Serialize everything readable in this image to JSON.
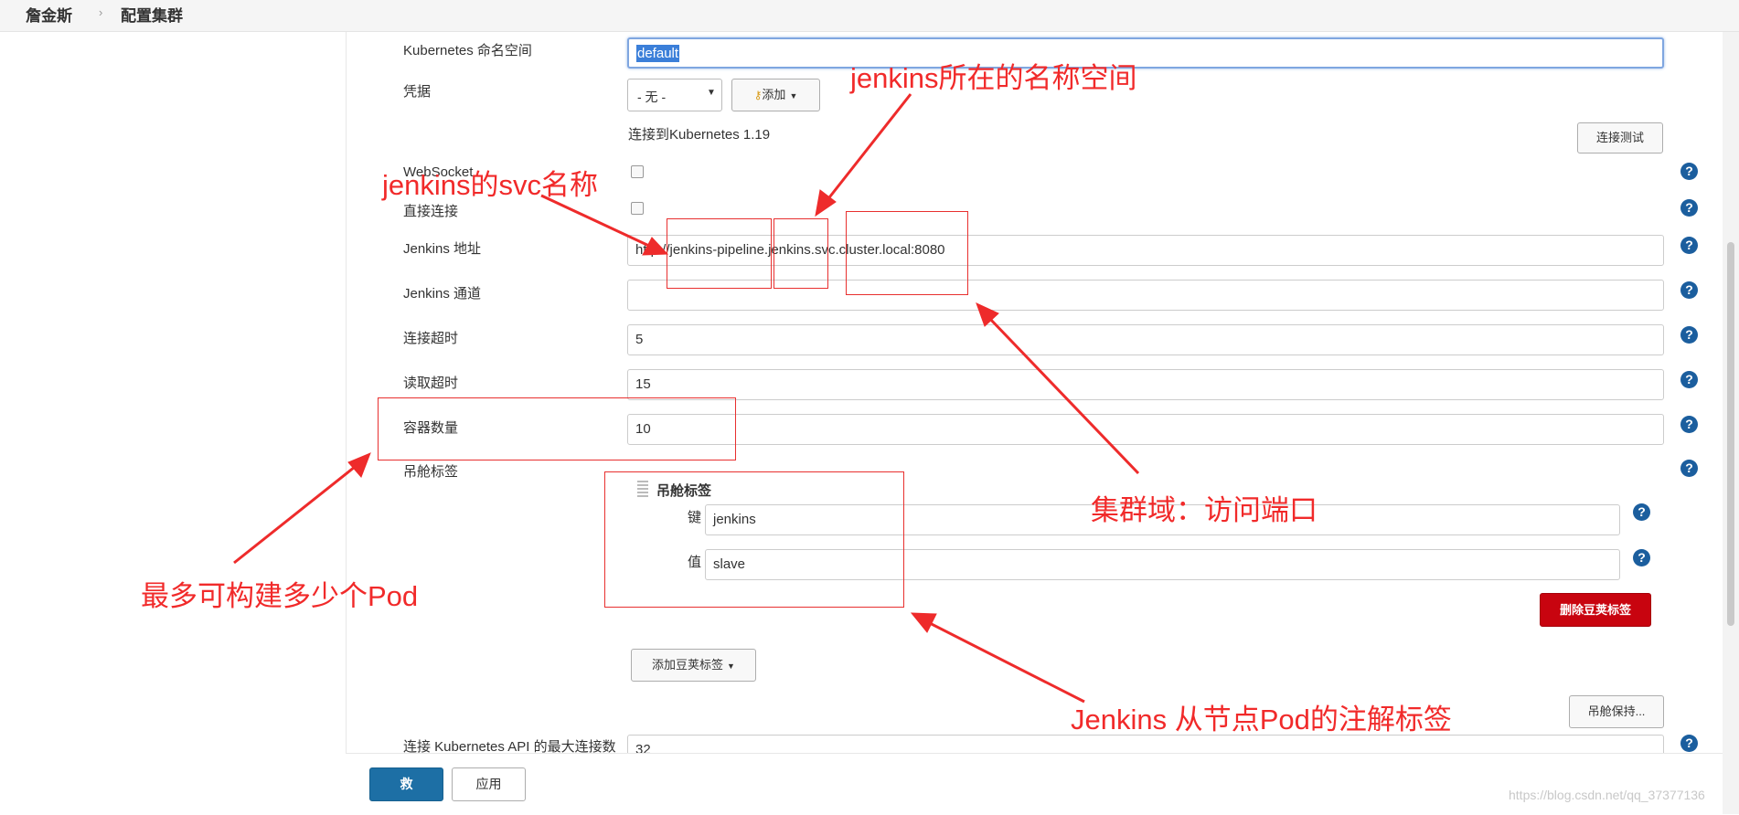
{
  "breadcrumb": {
    "home": "詹金斯",
    "separator": "›",
    "current": "配置集群"
  },
  "form": {
    "namespace": {
      "label": "Kubernetes 命名空间",
      "value": "default"
    },
    "credentials": {
      "label": "凭据",
      "select_value": "- 无 -",
      "add_button": "添加"
    },
    "connection_status": "连接到Kubernetes 1.19",
    "test_button": "连接测试",
    "websocket": {
      "label": "WebSocket"
    },
    "direct_connection": {
      "label": "直接连接"
    },
    "jenkins_url": {
      "label": "Jenkins 地址",
      "value": "http://jenkins-pipeline.jenkins.svc.cluster.local:8080"
    },
    "jenkins_tunnel": {
      "label": "Jenkins 通道",
      "value": ""
    },
    "connect_timeout": {
      "label": "连接超时",
      "value": "5"
    },
    "read_timeout": {
      "label": "读取超时",
      "value": "15"
    },
    "container_cap": {
      "label": "容器数量",
      "value": "10"
    },
    "pod_labels": {
      "label": "吊舱标签",
      "section_title": "吊舱标签",
      "key_label": "键",
      "key_value": "jenkins",
      "value_label": "值",
      "value_value": "slave",
      "delete_button": "删除豆荚标签",
      "add_button": "添加豆荚标签"
    },
    "pod_retention_button": "吊舱保持...",
    "max_connections": {
      "label": "连接 Kubernetes API 的最大连接数",
      "value": "32"
    }
  },
  "footer": {
    "save_button": "救",
    "apply_button": "应用"
  },
  "watermark": "https://blog.csdn.net/qq_37377136",
  "annotations": {
    "namespace_note": "jenkins所在的名称空间",
    "svc_note": "jenkins的svc名称",
    "cluster_domain_note": "集群域：访问端口",
    "pod_count_note": "最多可构建多少个Pod",
    "pod_labels_note": "Jenkins 从节点Pod的注解标签"
  },
  "colors": {
    "annotation": "#f12a2a",
    "help_icon": "#1b5e9e",
    "save_button": "#1d6fa5",
    "delete_button": "#c8040f"
  }
}
